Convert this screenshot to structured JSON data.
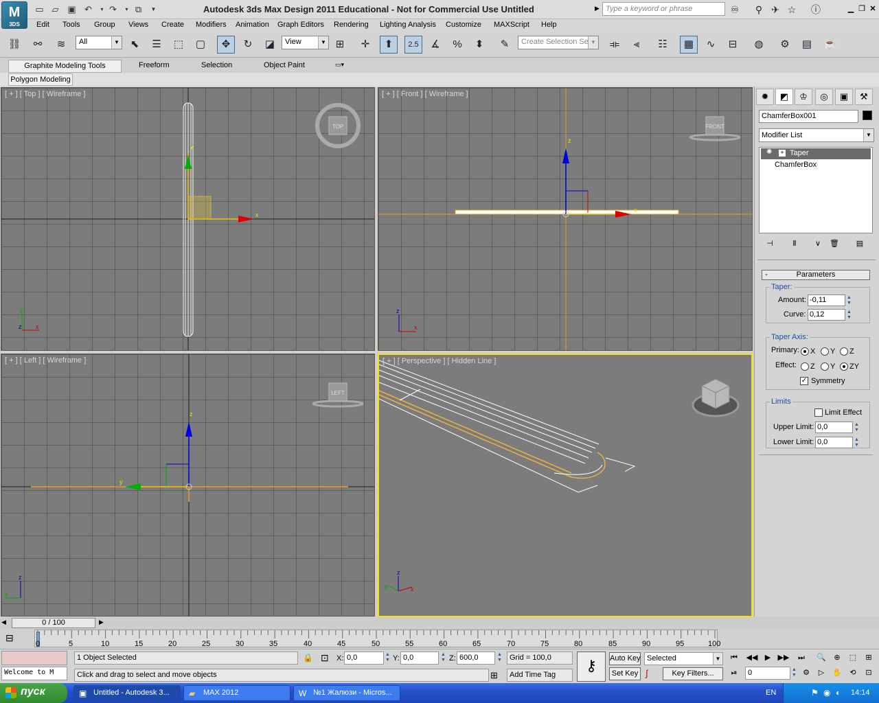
{
  "title_bar": {
    "logo_text": "3DS",
    "title": "Autodesk 3ds Max Design 2011    Educational - Not for Commercial Use    Untitled",
    "search_placeholder": "Type a keyword or phrase"
  },
  "menu": [
    "Edit",
    "Tools",
    "Group",
    "Views",
    "Create",
    "Modifiers",
    "Animation",
    "Graph Editors",
    "Rendering",
    "Lighting Analysis",
    "Customize",
    "MAXScript",
    "Help"
  ],
  "toolbar": {
    "selection_filter": "All",
    "reference_coord": "View",
    "snap_value": "2.5",
    "named_selection_placeholder": "Create Selection Se"
  },
  "ribbon": {
    "tabs": [
      "Graphite Modeling Tools",
      "Freeform",
      "Selection",
      "Object Paint"
    ],
    "sub_tab": "Polygon Modeling"
  },
  "viewports": {
    "top": {
      "label": "[ + ] [ Top ] [ Wireframe ]",
      "cube": "TOP"
    },
    "front": {
      "label": "[ + ] [ Front ] [ Wireframe ]",
      "cube": "FRONT"
    },
    "left": {
      "label": "[ + ] [ Left ] [ Wireframe ]",
      "cube": "LEFT"
    },
    "perspective": {
      "label": "[ + ] [ Perspective ] [ Hidden Line ]"
    },
    "axes": {
      "x": "x",
      "y": "y",
      "z": "z"
    }
  },
  "command_panel": {
    "object_name": "ChamferBox001",
    "object_color": "#000000",
    "modifier_list": "Modifier List",
    "stack": [
      "Taper",
      "ChamferBox"
    ],
    "rollout_title": "Parameters",
    "rollout_toggle": "-",
    "taper_group": "Taper:",
    "amount_label": "Amount:",
    "amount": "-0,11",
    "curve_label": "Curve:",
    "curve": "0,12",
    "axis_group": "Taper Axis:",
    "primary_label": "Primary:",
    "effect_label": "Effect:",
    "primary_options": [
      "X",
      "Y",
      "Z"
    ],
    "effect_options": [
      "Z",
      "Y",
      "ZY"
    ],
    "symmetry_label": "Symmetry",
    "limits_group": "Limits",
    "limit_effect_label": "Limit Effect",
    "upper_limit_label": "Upper Limit:",
    "upper_limit": "0,0",
    "lower_limit_label": "Lower Limit:",
    "lower_limit": "0,0"
  },
  "timeline": {
    "slider": "0 / 100",
    "ticks": [
      "0",
      "5",
      "10",
      "15",
      "20",
      "25",
      "30",
      "35",
      "40",
      "45",
      "50",
      "55",
      "60",
      "65",
      "70",
      "75",
      "80",
      "85",
      "90",
      "95",
      "100"
    ]
  },
  "status": {
    "listener": "Welcome to M",
    "selection": "1 Object Selected",
    "prompt": "Click and drag to select and move objects",
    "x_label": "X:",
    "x": "0,0",
    "y_label": "Y:",
    "y": "0,0",
    "z_label": "Z:",
    "z": "600,0",
    "grid": "Grid = 100,0",
    "add_time_tag": "Add Time Tag",
    "auto_key": "Auto Key",
    "set_key": "Set Key",
    "key_mode": "Selected",
    "key_filters": "Key Filters...",
    "frame": "0"
  },
  "taskbar": {
    "start": "пуск",
    "tasks": [
      "Untitled - Autodesk 3...",
      "MAX 2012",
      "№1 Жалюзи - Micros..."
    ],
    "lang": "EN",
    "clock": "14:14"
  }
}
